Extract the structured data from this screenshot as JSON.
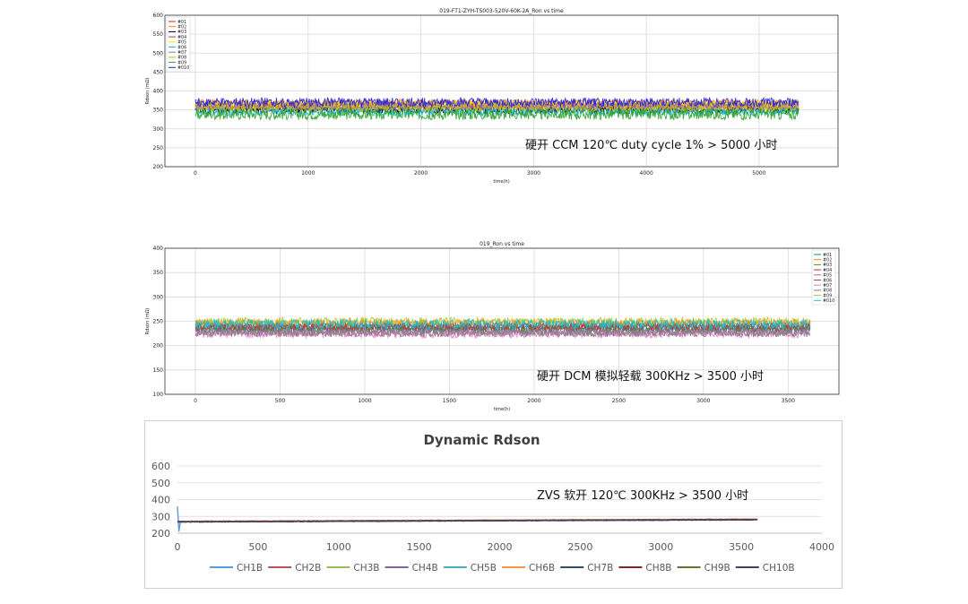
{
  "chart_data": [
    {
      "type": "line",
      "title": "019-FT1-ZYH-TS003-520V-60K-2A_Ron vs time",
      "xlabel": "time(h)",
      "ylabel": "Rdson (mΩ)",
      "xlim": [
        -270,
        5700
      ],
      "ylim": [
        200,
        600
      ],
      "xticks": [
        0,
        1000,
        2000,
        3000,
        4000,
        5000
      ],
      "yticks": [
        200,
        250,
        300,
        350,
        400,
        450,
        500,
        550,
        600
      ],
      "grid": true,
      "legend_position": "top-left",
      "annotation": "硬开 CCM 120℃  duty cycle 1%    > 5000 小时",
      "x_max_data": 5350,
      "series": [
        {
          "name": "#01",
          "center": 358,
          "spread": 10,
          "color": "#d62728"
        },
        {
          "name": "#02",
          "center": 368,
          "spread": 10,
          "color": "#ff7f0e"
        },
        {
          "name": "#03",
          "center": 350,
          "spread": 10,
          "color": "#000000"
        },
        {
          "name": "#04",
          "center": 362,
          "spread": 10,
          "color": "#8c564b"
        },
        {
          "name": "#05",
          "center": 365,
          "spread": 10,
          "color": "#ffd700"
        },
        {
          "name": "#06",
          "center": 345,
          "spread": 12,
          "color": "#17becf"
        },
        {
          "name": "#07",
          "center": 360,
          "spread": 10,
          "color": "#9467bd"
        },
        {
          "name": "#08",
          "center": 355,
          "spread": 10,
          "color": "#bcbd22"
        },
        {
          "name": "#09",
          "center": 338,
          "spread": 14,
          "color": "#2ca02c"
        },
        {
          "name": "#010",
          "center": 370,
          "spread": 12,
          "color": "#1f1fe0"
        }
      ]
    },
    {
      "type": "line",
      "title": "019_Ron vs time",
      "xlabel": "time(h)",
      "ylabel": "Rdson (mΩ)",
      "xlim": [
        -180,
        3800
      ],
      "ylim": [
        100,
        400
      ],
      "xticks": [
        0,
        500,
        1000,
        1500,
        2000,
        2500,
        3000,
        3500
      ],
      "yticks": [
        100,
        150,
        200,
        250,
        300,
        350,
        400
      ],
      "grid": true,
      "legend_position": "top-right",
      "annotation": "硬开 DCM  模拟轻载  300KHz    > 3500 小时",
      "x_max_data": 3630,
      "series": [
        {
          "name": "#01",
          "center": 238,
          "spread": 8,
          "color": "#1f77b4"
        },
        {
          "name": "#02",
          "center": 246,
          "spread": 8,
          "color": "#ff7f0e"
        },
        {
          "name": "#03",
          "center": 232,
          "spread": 8,
          "color": "#2ca02c"
        },
        {
          "name": "#04",
          "center": 240,
          "spread": 8,
          "color": "#d62728"
        },
        {
          "name": "#05",
          "center": 228,
          "spread": 8,
          "color": "#9467bd"
        },
        {
          "name": "#06",
          "center": 236,
          "spread": 8,
          "color": "#8c564b"
        },
        {
          "name": "#07",
          "center": 224,
          "spread": 8,
          "color": "#e377c2"
        },
        {
          "name": "#08",
          "center": 226,
          "spread": 8,
          "color": "#7f7f7f"
        },
        {
          "name": "#09",
          "center": 250,
          "spread": 8,
          "color": "#bcbd22"
        },
        {
          "name": "#010",
          "center": 244,
          "spread": 10,
          "color": "#17becf"
        }
      ]
    },
    {
      "type": "line",
      "title": "Dynamic Rdson",
      "xlabel": "",
      "ylabel": "",
      "xlim": [
        0,
        4000
      ],
      "ylim": [
        200,
        600
      ],
      "xticks": [
        0,
        500,
        1000,
        1500,
        2000,
        2500,
        3000,
        3500,
        4000
      ],
      "yticks": [
        200,
        300,
        400,
        500,
        600
      ],
      "grid": true,
      "legend_position": "bottom",
      "annotation": "ZVS 软开  120℃  300KHz    > 3500 小时",
      "x_max_data": 3600,
      "series": [
        {
          "name": "CH1B",
          "start": 268,
          "end": 282,
          "color": "#5b9bd5"
        },
        {
          "name": "CH2B",
          "start": 270,
          "end": 283,
          "color": "#c0504d"
        },
        {
          "name": "CH3B",
          "start": 269,
          "end": 282,
          "color": "#9bbb59"
        },
        {
          "name": "CH4B",
          "start": 268,
          "end": 281,
          "color": "#8064a2"
        },
        {
          "name": "CH5B",
          "start": 270,
          "end": 282,
          "color": "#4bacc6"
        },
        {
          "name": "CH6B",
          "start": 271,
          "end": 284,
          "color": "#f79646"
        },
        {
          "name": "CH7B",
          "start": 267,
          "end": 280,
          "color": "#2c4d75"
        },
        {
          "name": "CH8B",
          "start": 268,
          "end": 281,
          "color": "#772c2a"
        },
        {
          "name": "CH9B",
          "start": 269,
          "end": 282,
          "color": "#5f7530"
        },
        {
          "name": "CH10B",
          "start": 268,
          "end": 281,
          "color": "#4d3b62"
        }
      ]
    }
  ]
}
